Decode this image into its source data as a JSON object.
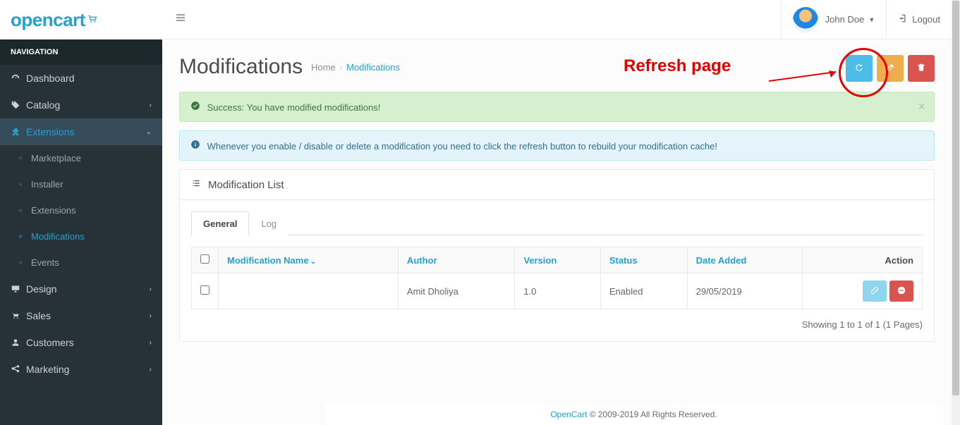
{
  "brand": "opencart",
  "header": {
    "user_name": "John Doe",
    "logout": "Logout"
  },
  "nav": {
    "header": "NAVIGATION",
    "items": [
      {
        "label": "Dashboard"
      },
      {
        "label": "Catalog"
      },
      {
        "label": "Extensions"
      },
      {
        "label": "Design"
      },
      {
        "label": "Sales"
      },
      {
        "label": "Customers"
      },
      {
        "label": "Marketing"
      }
    ],
    "ext_sub": [
      {
        "label": "Marketplace"
      },
      {
        "label": "Installer"
      },
      {
        "label": "Extensions"
      },
      {
        "label": "Modifications"
      },
      {
        "label": "Events"
      }
    ]
  },
  "page": {
    "title": "Modifications",
    "breadcrumb_home": "Home",
    "breadcrumb_current": "Modifications"
  },
  "annotation": "Refresh page",
  "alerts": {
    "success": "Success: You have modified modifications!",
    "info": "Whenever you enable / disable or delete a modification you need to click the refresh button to rebuild your modification cache!"
  },
  "panel": {
    "heading": "Modification List",
    "tab_general": "General",
    "tab_log": "Log"
  },
  "table": {
    "col_name": "Modification Name",
    "col_author": "Author",
    "col_version": "Version",
    "col_status": "Status",
    "col_date": "Date Added",
    "col_action": "Action",
    "rows": [
      {
        "name": "",
        "author": "Amit Dholiya",
        "version": "1.0",
        "status": "Enabled",
        "date": "29/05/2019"
      }
    ],
    "pagination": "Showing 1 to 1 of 1 (1 Pages)"
  },
  "footer": {
    "brand": "OpenCart",
    "text": " © 2009-2019 All Rights Reserved."
  }
}
